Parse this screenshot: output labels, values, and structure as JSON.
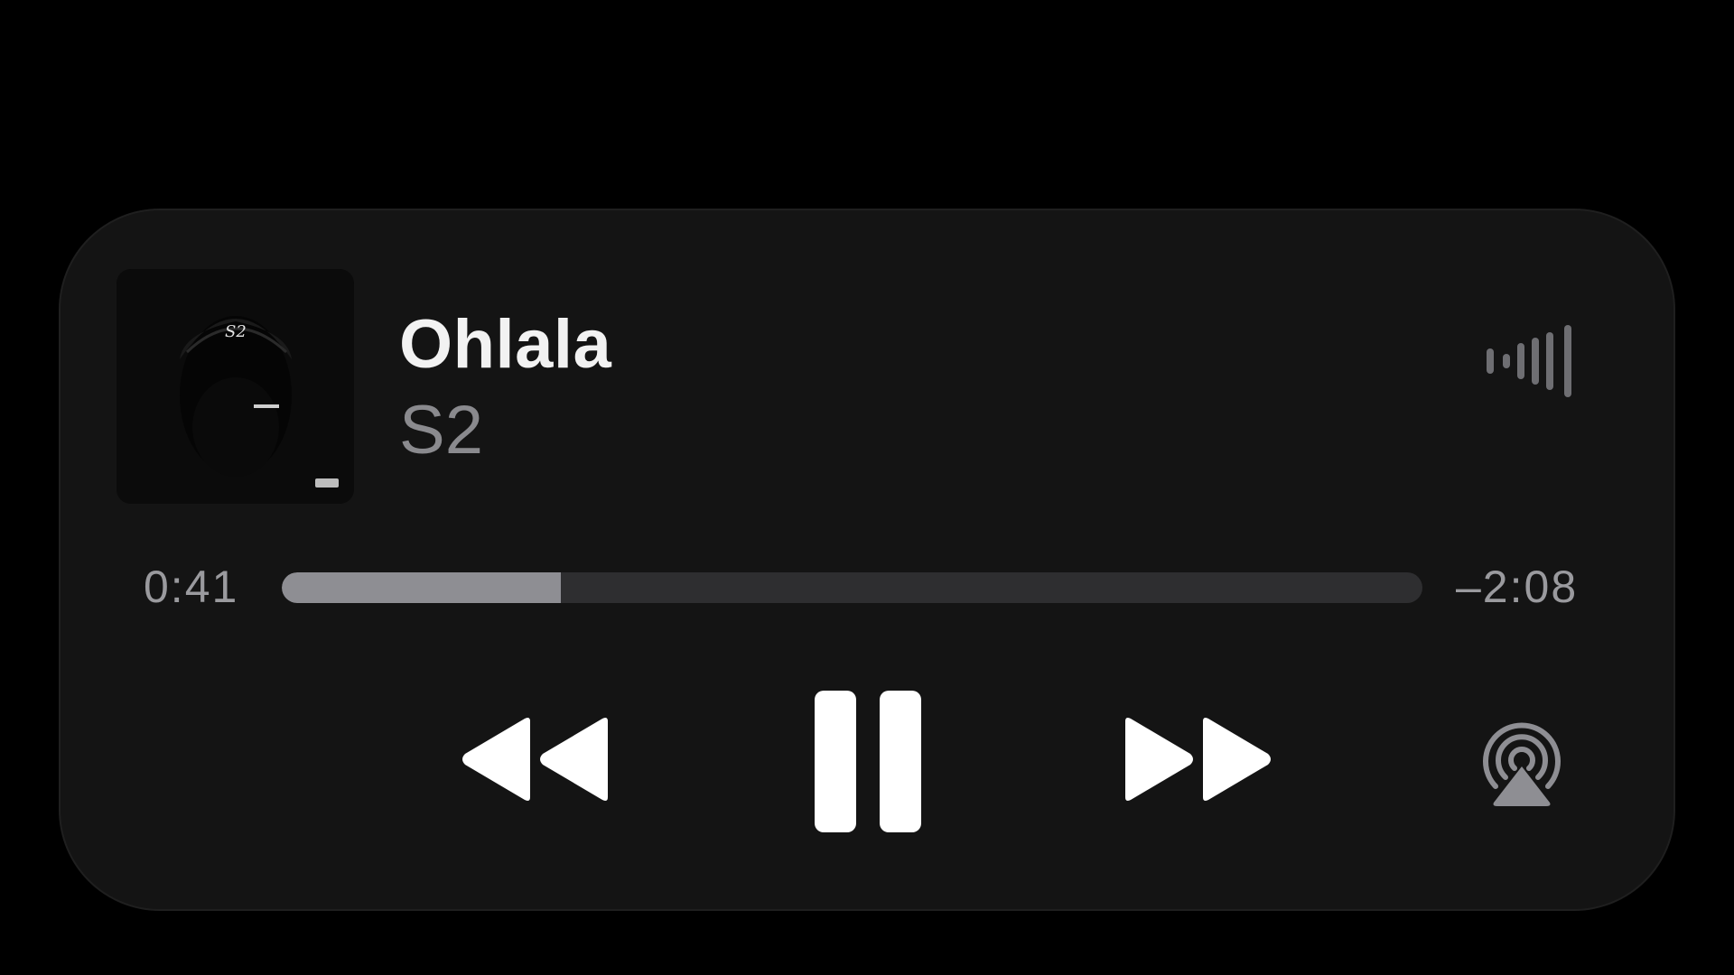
{
  "now_playing": {
    "title": "Ohlala",
    "artist": "S2",
    "artwork_icon": "album-artwork",
    "artwork_text": "S2",
    "elapsed": "0:41",
    "remaining": "–2:08",
    "progress_fraction": 0.245
  },
  "icons": {
    "waveform": "waveform-icon",
    "rewind": "rewind-icon",
    "pause": "pause-icon",
    "forward": "fast-forward-icon",
    "airplay": "airplay-icon"
  },
  "colors": {
    "background": "#000000",
    "card": "#141414",
    "title": "#f2f2f2",
    "secondary": "#8a8a8e",
    "progress_fill": "#8e8e93",
    "progress_track": "#2e2e30",
    "controls": "#ffffff"
  }
}
